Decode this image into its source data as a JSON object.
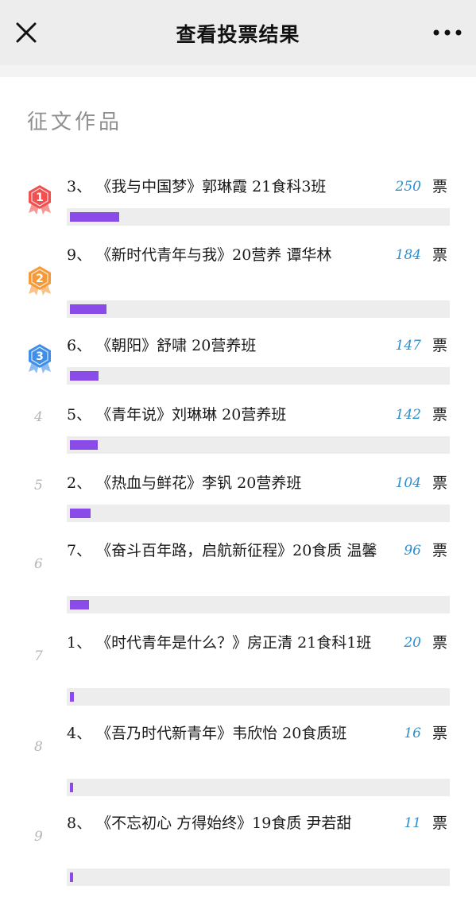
{
  "header": {
    "title": "查看投票结果",
    "close_icon": "close-icon",
    "more_icon": "more-icon"
  },
  "section": {
    "title": "征文作品"
  },
  "colors": {
    "bar": "#8a4be8",
    "votes": "#2f8fcc",
    "rank1": "#f0504f",
    "rank2": "#f59a3a",
    "rank3": "#3f8fe8"
  },
  "vote_unit": "票",
  "entries": [
    {
      "rank": "1",
      "text": "3、 《我与中国梦》郭琳霞 21食科3班",
      "votes": "250",
      "vote_value": 250
    },
    {
      "rank": "2",
      "text": "9、 《新时代青年与我》20营养 谭华林",
      "votes": "184",
      "vote_value": 184
    },
    {
      "rank": "3",
      "text": "6、 《朝阳》舒啸 20营养班",
      "votes": "147",
      "vote_value": 147
    },
    {
      "rank": "4",
      "text": "5、 《青年说》刘琳琳 20营养班",
      "votes": "142",
      "vote_value": 142
    },
    {
      "rank": "5",
      "text": "2、 《热血与鲜花》李钒 20营养班",
      "votes": "104",
      "vote_value": 104
    },
    {
      "rank": "6",
      "text": "7、 《奋斗百年路，启航新征程》20食质 温馨",
      "votes": "96",
      "vote_value": 96
    },
    {
      "rank": "7",
      "text": "1、 《时代青年是什么？》房正清 21食科1班",
      "votes": "20",
      "vote_value": 20
    },
    {
      "rank": "8",
      "text": "4、 《吾乃时代新青年》韦欣怡 20食质班",
      "votes": "16",
      "vote_value": 16
    },
    {
      "rank": "9",
      "text": "8、 《不忘初心 方得始终》19食质 尹若甜",
      "votes": "11",
      "vote_value": 11
    }
  ]
}
